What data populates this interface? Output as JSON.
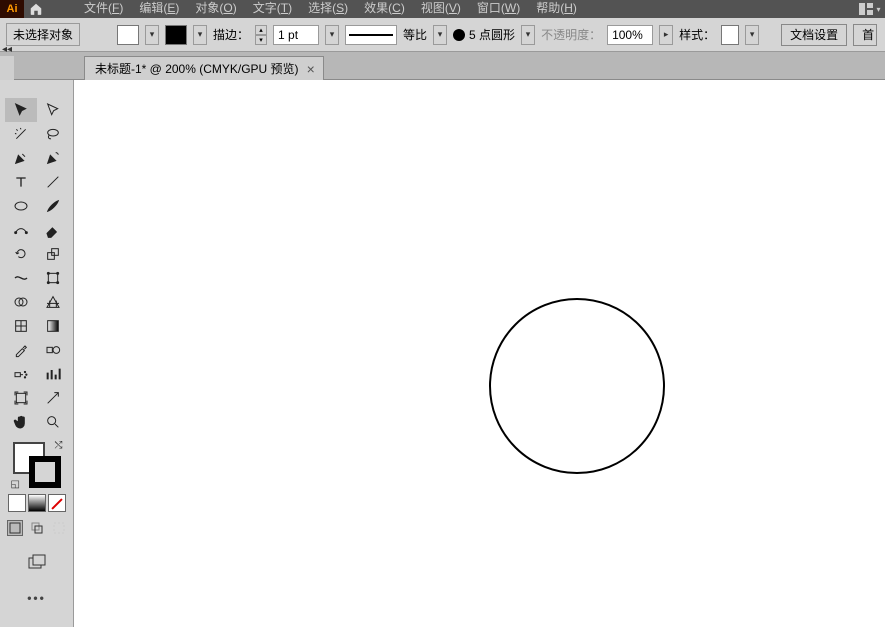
{
  "menubar": {
    "items": [
      {
        "label": "文件",
        "key": "F"
      },
      {
        "label": "编辑",
        "key": "E"
      },
      {
        "label": "对象",
        "key": "O"
      },
      {
        "label": "文字",
        "key": "T"
      },
      {
        "label": "选择",
        "key": "S"
      },
      {
        "label": "效果",
        "key": "C"
      },
      {
        "label": "视图",
        "key": "V"
      },
      {
        "label": "窗口",
        "key": "W"
      },
      {
        "label": "帮助",
        "key": "H"
      }
    ]
  },
  "options": {
    "selection_label": "未选择对象",
    "stroke_label": "描边：",
    "stroke_weight": "1 pt",
    "proportion_label": "等比",
    "profile_label": "5 点圆形",
    "opacity_label": "不透明度：",
    "opacity_value": "100%",
    "style_label": "样式：",
    "docsetup_btn": "文档设置",
    "pref_btn": "首"
  },
  "tab": {
    "title": "未标题-1* @ 200% (CMYK/GPU 预览)"
  },
  "toolbox": {
    "title_placeholder": ""
  },
  "canvas": {
    "shape": "circle"
  }
}
